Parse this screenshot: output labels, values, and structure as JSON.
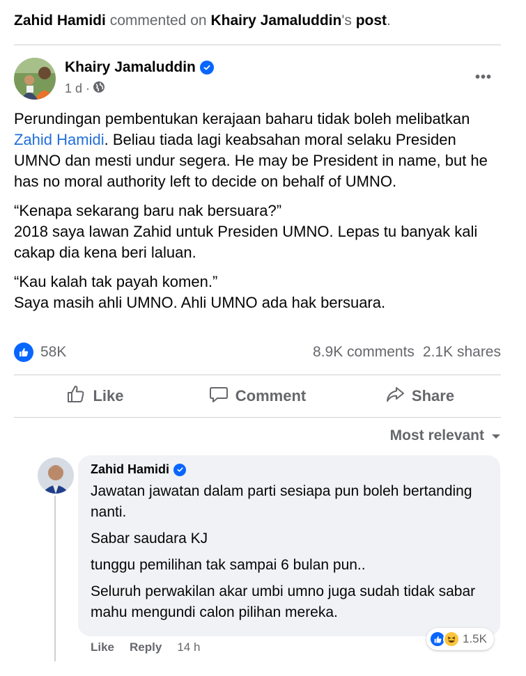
{
  "activity": {
    "actor": "Zahid Hamidi",
    "verb": " commented on ",
    "target": "Khairy Jamaluddin",
    "suffix_owner": "'s ",
    "suffix_post": "post",
    "period": "."
  },
  "post": {
    "author": "Khairy Jamaluddin",
    "time": "1 d ·",
    "more_label": "•••",
    "paragraph1_a": "Perundingan pembentukan kerajaan baharu tidak boleh melibatkan ",
    "paragraph1_link": "Zahid Hamidi",
    "paragraph1_b": ". Beliau tiada lagi keabsahan moral selaku Presiden UMNO dan mesti undur segera. He may be President in name, but he has no moral authority left to decide on behalf of UMNO.",
    "paragraph2_line1": "“Kenapa sekarang baru nak bersuara?”",
    "paragraph2_line2": "2018 saya lawan Zahid untuk Presiden UMNO. Lepas tu banyak kali cakap dia kena beri laluan.",
    "paragraph3_line1": "“Kau kalah tak payah komen.”",
    "paragraph3_line2": "Saya masih ahli UMNO. Ahli UMNO ada hak bersuara.",
    "reactions_count": "58K",
    "comments_count": "8.9K comments",
    "shares_count": "2.1K shares"
  },
  "actions": {
    "like": "Like",
    "comment": "Comment",
    "share": "Share"
  },
  "sort": {
    "label": "Most relevant"
  },
  "comment": {
    "author": "Zahid Hamidi",
    "lines": [
      "Jawatan jawatan dalam parti sesiapa pun boleh bertanding nanti.",
      "Sabar saudara KJ",
      "tunggu pemilihan tak sampai 6 bulan pun..",
      "Seluruh perwakilan akar umbi umno juga sudah tidak sabar mahu mengundi calon pilihan mereka."
    ],
    "like_label": "Like",
    "reply_label": "Reply",
    "time": "14 h",
    "reaction_count": "1.5K"
  },
  "colors": {
    "accent": "#0866ff",
    "link": "#216fdb",
    "muted": "#65676b",
    "bubble": "#f0f2f5"
  }
}
